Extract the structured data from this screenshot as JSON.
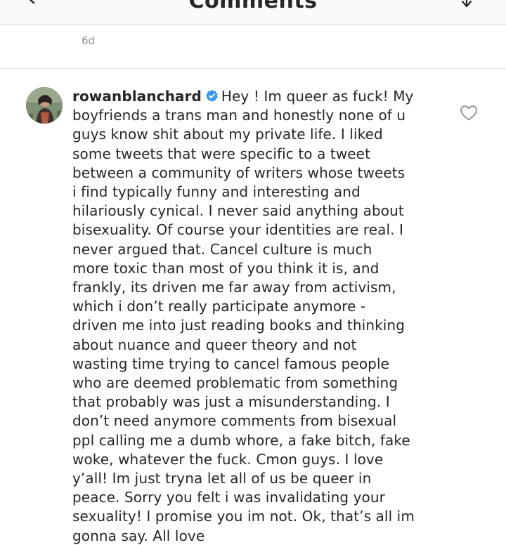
{
  "header": {
    "title": "Comments",
    "back_icon": "chevron-left-icon",
    "share_icon": "send-icon"
  },
  "previous_comment": {
    "time": "6d"
  },
  "comment": {
    "username": "rowanblanchard",
    "verified_icon": "verified-badge-icon",
    "like_icon": "heart-outline-icon",
    "lines": [
      "Hey ! Im queer as fuck! My",
      "boyfriends a trans man and honestly none of u",
      "guys know shit about my private life. I liked",
      "some tweets that were specific to a tweet",
      "between a community of writers whose tweets",
      "i find typically funny and interesting and",
      "hilariously cynical. I never said anything about",
      "bisexuality. Of course your identities are real. I",
      "never argued that. Cancel culture is much",
      "more toxic than most of you think it is, and",
      "frankly, its driven me far away from activism,",
      "which i don’t really participate anymore -",
      "driven me into just reading books and thinking",
      "about nuance and queer theory and not",
      "wasting time trying to cancel famous people",
      "who are deemed problematic from something",
      "that probably was just a misunderstanding. I",
      "don’t need anymore comments from bisexual",
      "ppl calling me a dumb whore, a fake bitch, fake",
      "woke, whatever the fuck. Cmon guys. I love",
      "y’all! Im just tryna let all of us be queer in",
      "peace. Sorry you felt i was invalidating your",
      "sexuality! I promise you im not. Ok, that’s all im",
      "gonna say. All love"
    ]
  },
  "colors": {
    "text": "#262626",
    "muted": "#8e8e8e",
    "verified": "#3897f0",
    "border": "#dbdbdb"
  }
}
